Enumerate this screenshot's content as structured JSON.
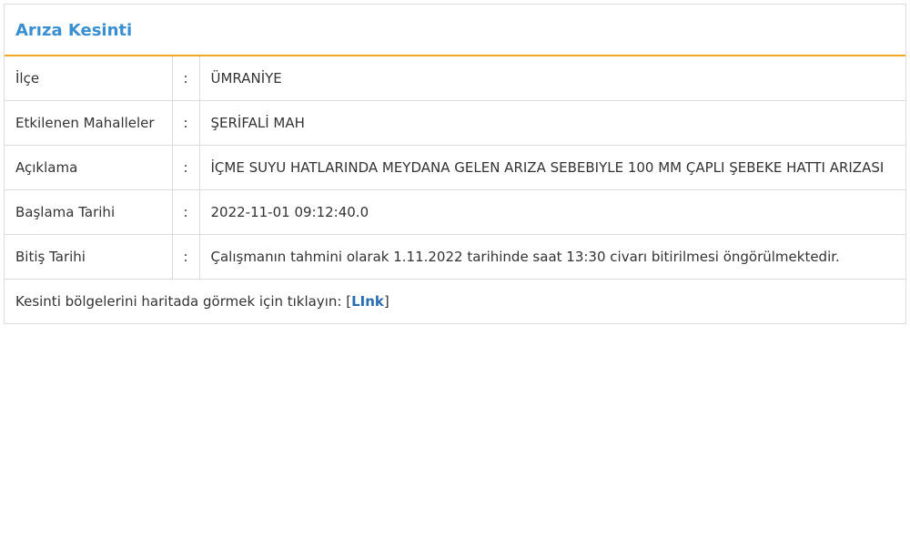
{
  "panel": {
    "title": "Arıza Kesinti"
  },
  "rows": [
    {
      "label": "İlçe",
      "separator": ":",
      "value": "ÜMRANİYE"
    },
    {
      "label": "Etkilenen Mahalleler",
      "separator": ":",
      "value": "ŞERİFALİ MAH"
    },
    {
      "label": "Açıklama",
      "separator": ":",
      "value": "İÇME SUYU HATLARINDA MEYDANA GELEN ARIZA SEBEBIYLE 100 MM ÇAPLI ŞEBEKE HATTI ARIZASI"
    },
    {
      "label": "Başlama Tarihi",
      "separator": ":",
      "value": "2022-11-01 09:12:40.0"
    },
    {
      "label": "Bitiş Tarihi",
      "separator": ":",
      "value": "Çalışmanın tahmini olarak 1.11.2022 tarihinde saat 13:30 civarı bitirilmesi öngörülmektedir."
    }
  ],
  "footer": {
    "text": "Kesinti bölgelerini haritada görmek için tıklayın: ",
    "link_open": "[",
    "link_label": "LInk",
    "link_close": "]"
  },
  "colors": {
    "title": "#3a8fd0",
    "header_rule": "#f5a623",
    "link": "#2a6db0",
    "border": "#dcdcdc"
  }
}
